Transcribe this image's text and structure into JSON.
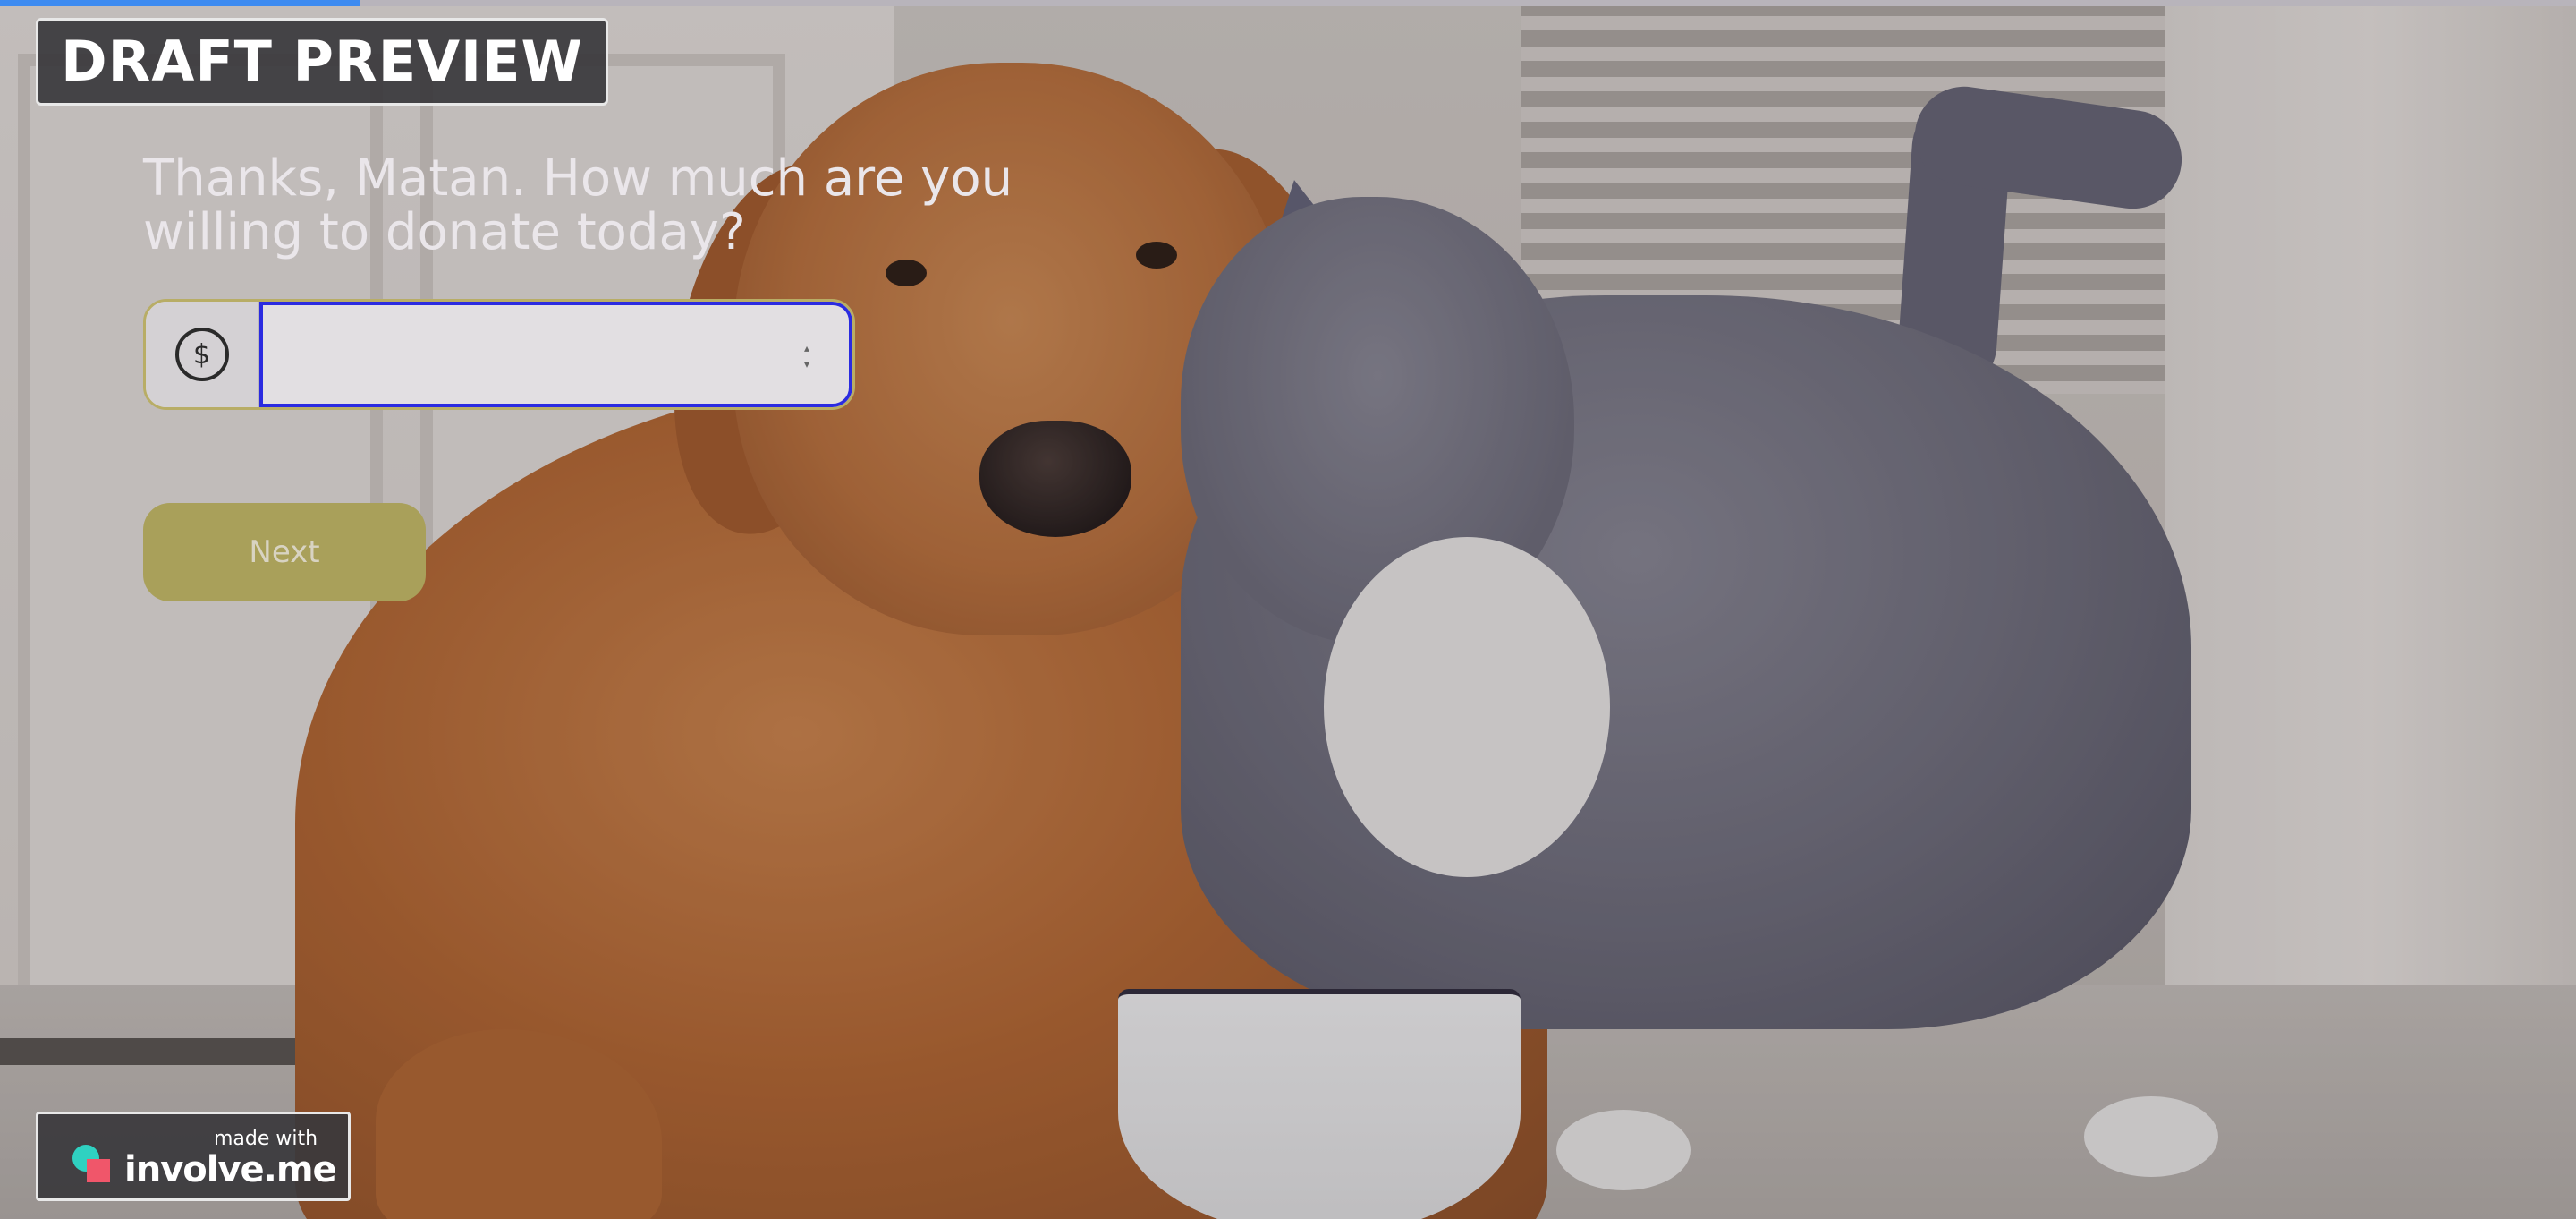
{
  "progress": {
    "fraction": 0.14,
    "color": "#3d8bf0"
  },
  "badge": {
    "label": "DRAFT PREVIEW"
  },
  "question": {
    "text": "Thanks, Matan. How much are you willing to donate today?"
  },
  "amount_input": {
    "currency_symbol": "$",
    "value": "",
    "placeholder": ""
  },
  "next_button": {
    "label": "Next",
    "color": "#a9a05a"
  },
  "footer_badge": {
    "made_with_label": "made with",
    "brand_name": "involve.me",
    "brand_colors": [
      "#2fd1c1",
      "#f0566a"
    ]
  },
  "background": {
    "subject": "dog-and-cat-photo"
  }
}
